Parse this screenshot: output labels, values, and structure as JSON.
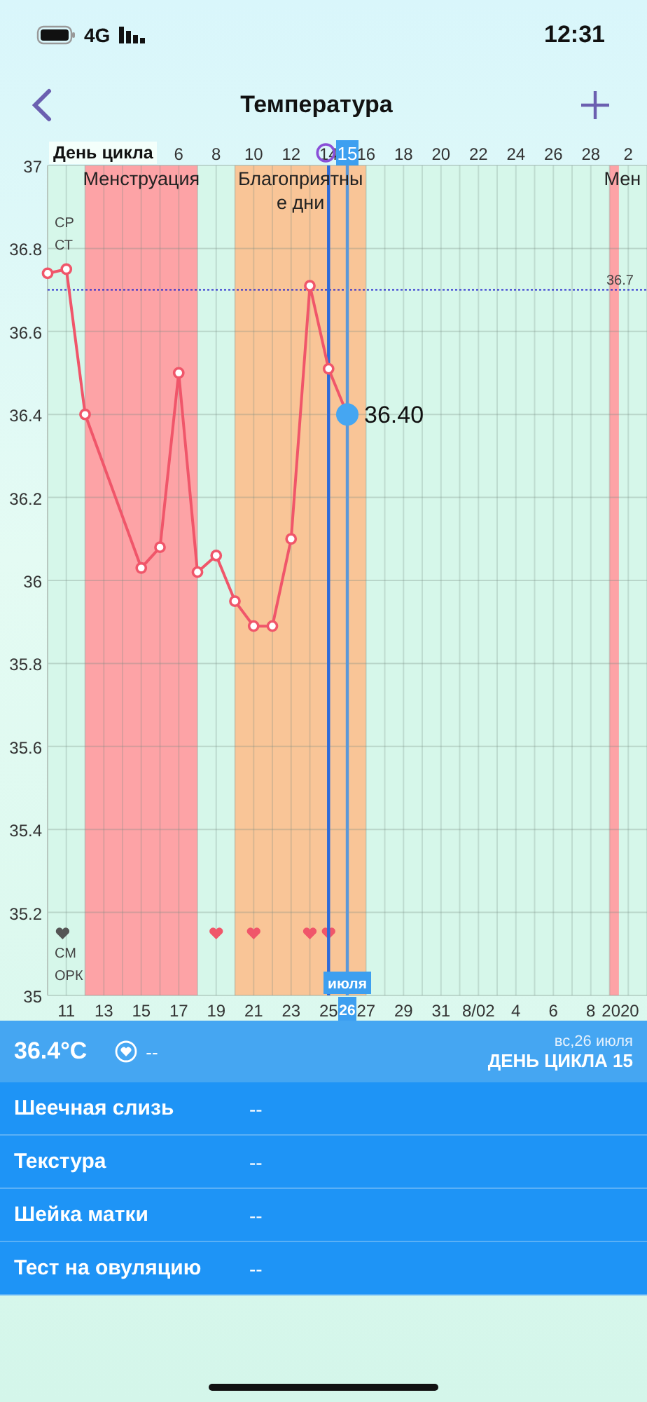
{
  "status_bar": {
    "network": "4G",
    "time": "12:31"
  },
  "nav": {
    "title": "Температура"
  },
  "chart": {
    "axis_title": "День цикла",
    "next_cycle_tick": "2",
    "chart_data": {
      "type": "line",
      "grid": true,
      "x": [
        -1,
        0,
        1,
        4,
        5,
        6,
        7,
        8,
        9,
        10,
        11,
        12,
        13,
        14,
        15
      ],
      "series": [
        {
          "color": "#f0566a",
          "marker": "o",
          "values": [
            36.74,
            36.75,
            36.4,
            36.03,
            36.08,
            36.5,
            36.02,
            36.06,
            35.95,
            35.89,
            35.89,
            36.1,
            36.71,
            36.51,
            36.4
          ]
        }
      ],
      "xlim": [
        -1,
        31
      ],
      "ylim": [
        35,
        37
      ],
      "xticks": [
        {
          "value": 6,
          "label": "6"
        },
        {
          "value": 8,
          "label": "8"
        },
        {
          "value": 10,
          "label": "10"
        },
        {
          "value": 12,
          "label": "12"
        },
        {
          "value": 14,
          "label": "14"
        },
        {
          "value": 16,
          "label": "16"
        },
        {
          "value": 18,
          "label": "18"
        },
        {
          "value": 20,
          "label": "20"
        },
        {
          "value": 22,
          "label": "22"
        },
        {
          "value": 24,
          "label": "24"
        },
        {
          "value": 26,
          "label": "26"
        },
        {
          "value": 28,
          "label": "28"
        }
      ],
      "yticks": [
        {
          "value": 37,
          "label": "37"
        },
        {
          "value": 36.8,
          "label": "36.8"
        },
        {
          "value": 36.6,
          "label": "36.6"
        },
        {
          "value": 36.4,
          "label": "36.4"
        },
        {
          "value": 36.2,
          "label": "36.2"
        },
        {
          "value": 36,
          "label": "36"
        },
        {
          "value": 35.8,
          "label": "35.8"
        },
        {
          "value": 35.6,
          "label": "35.6"
        },
        {
          "value": 35.4,
          "label": "35.4"
        },
        {
          "value": 35.2,
          "label": "35.2"
        },
        {
          "value": 35,
          "label": "35"
        }
      ],
      "ref_lines": [
        {
          "axis": "y",
          "value": 36.7,
          "label": "36.7",
          "color": "#2a2ad0"
        },
        {
          "axis": "x",
          "value": 14,
          "color": "#2d6ad8"
        },
        {
          "axis": "x",
          "value": 15,
          "color": "#5b98d8"
        }
      ]
    },
    "bands": [
      {
        "kind": "period",
        "label": "Менструация"
      },
      {
        "kind": "fertile",
        "label": "Благоприятные дни"
      },
      {
        "kind": "period",
        "label": "Мен"
      }
    ],
    "hearts": [
      {
        "color": "#555555"
      },
      {
        "color": "#f0566a"
      },
      {
        "color": "#f0566a"
      },
      {
        "color": "#f0566a"
      },
      {
        "color": "#f0566a"
      }
    ],
    "date_axis": [
      "11",
      "13",
      "15",
      "17",
      "19",
      "21",
      "23",
      "25",
      "27",
      "29",
      "31",
      "8/02",
      "4",
      "6",
      "8"
    ],
    "year": "2020",
    "side_labels_top": [
      "СР",
      "СТ"
    ],
    "side_labels_bottom": [
      "СМ",
      "ОРК"
    ],
    "selected": {
      "label": "15",
      "value_label": "36.40",
      "month": "июля",
      "date": "26"
    }
  },
  "summary": {
    "temperature": "36.4°C",
    "mucus": "--",
    "date": "вс,26 июля",
    "cycle_day": "ДЕНЬ ЦИКЛА 15"
  },
  "rows": [
    {
      "label": "Шеечная слизь",
      "value": "--"
    },
    {
      "label": "Текстура",
      "value": "--"
    },
    {
      "label": "Шейка матки",
      "value": "--"
    },
    {
      "label": "Тест на овуляцию",
      "value": "--"
    }
  ]
}
